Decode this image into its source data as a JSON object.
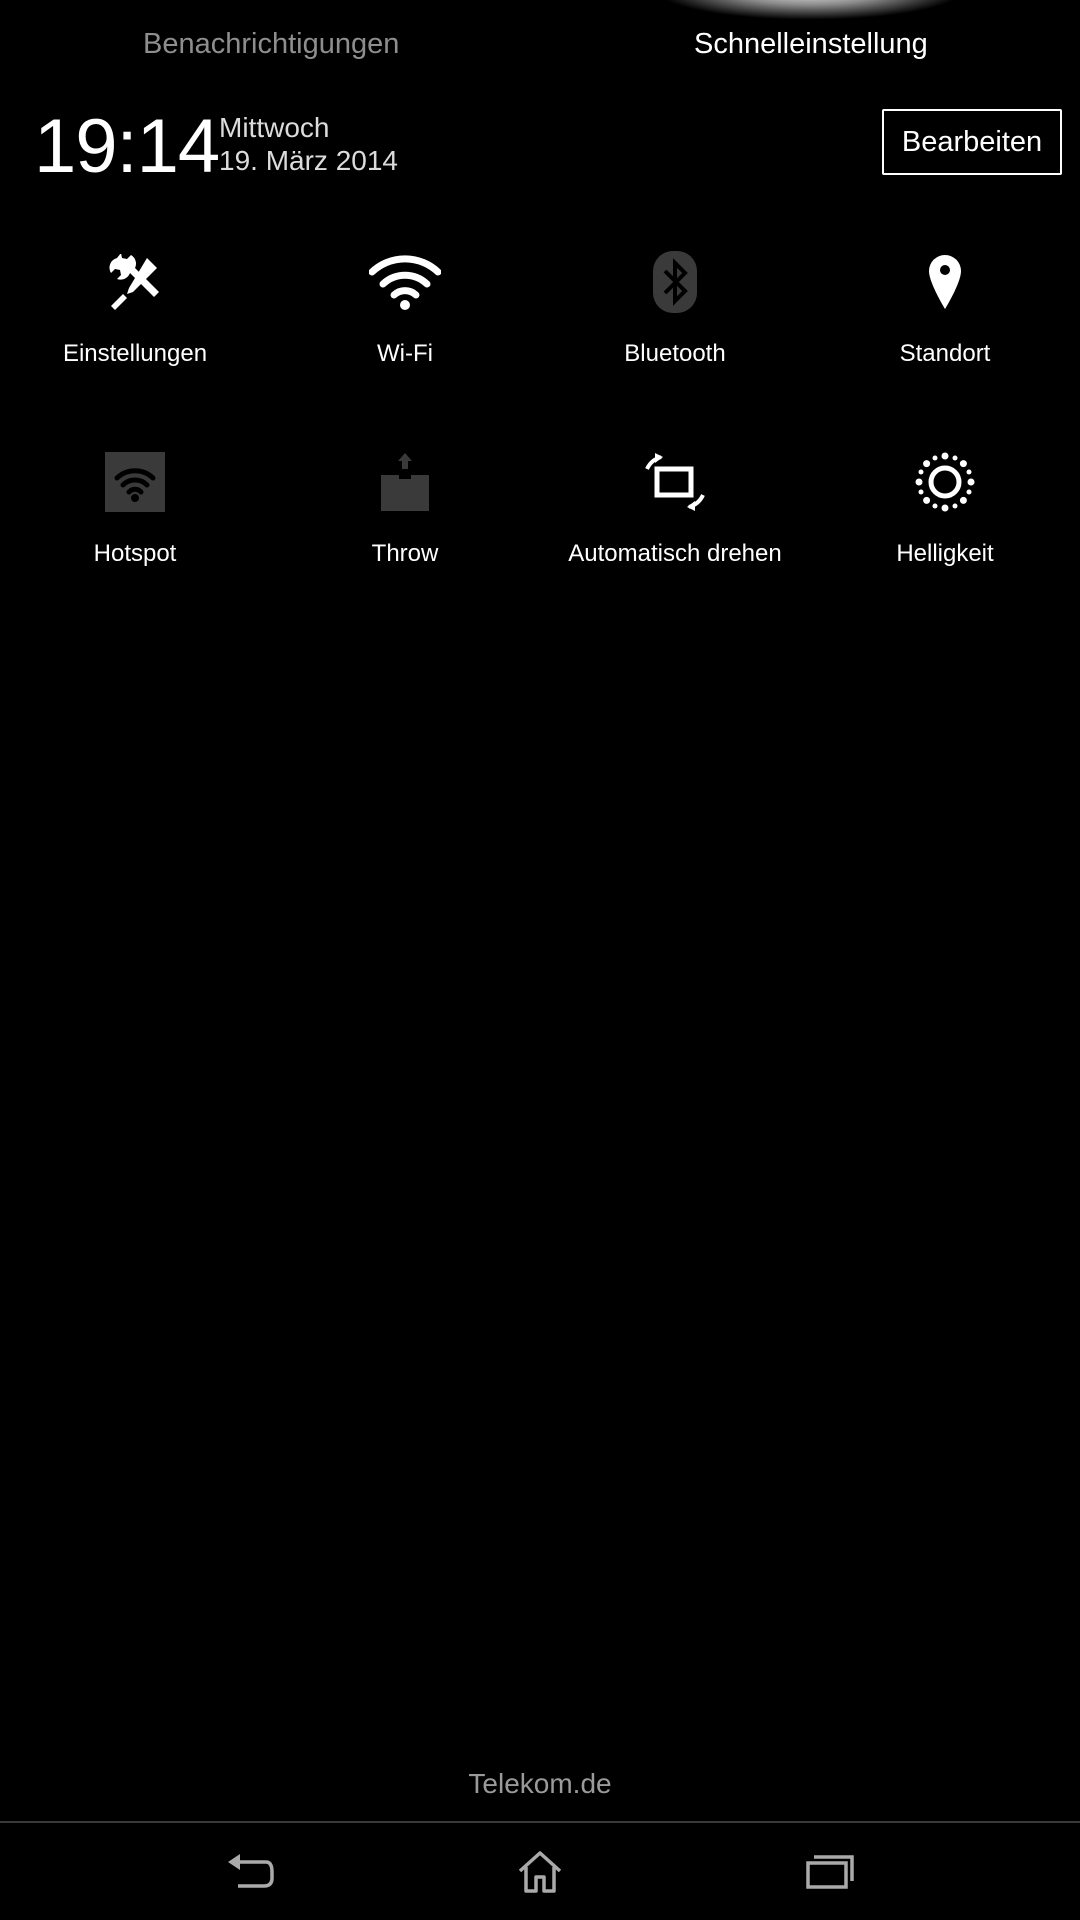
{
  "tabs": {
    "notifications": "Benachrichtigungen",
    "quick_settings": "Schnelleinstellung"
  },
  "header": {
    "time": "19:14",
    "weekday": "Mittwoch",
    "date": "19. März 2014",
    "edit_label": "Bearbeiten"
  },
  "tiles": [
    {
      "label": "Einstellungen",
      "icon": "settings-tools-icon",
      "state": "on"
    },
    {
      "label": "Wi-Fi",
      "icon": "wifi-icon",
      "state": "on"
    },
    {
      "label": "Bluetooth",
      "icon": "bluetooth-icon",
      "state": "off"
    },
    {
      "label": "Standort",
      "icon": "location-pin-icon",
      "state": "on"
    },
    {
      "label": "Hotspot",
      "icon": "hotspot-icon",
      "state": "off"
    },
    {
      "label": "Throw",
      "icon": "throw-icon",
      "state": "off"
    },
    {
      "label": "Automatisch drehen",
      "icon": "auto-rotate-icon",
      "state": "on"
    },
    {
      "label": "Helligkeit",
      "icon": "brightness-icon",
      "state": "on"
    }
  ],
  "footer": {
    "carrier": "Telekom.de"
  },
  "navbar": {
    "back": "back-icon",
    "home": "home-icon",
    "recents": "recents-icon"
  },
  "colors": {
    "background": "#000000",
    "inactive_icon": "#3a3a3a",
    "inactive_tab": "#8e8e8e"
  }
}
